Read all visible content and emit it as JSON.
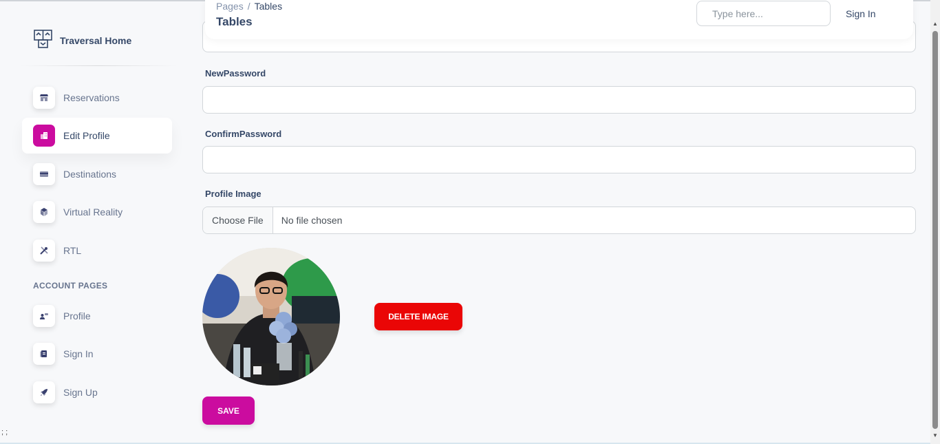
{
  "sidebar": {
    "brand_title": "Traversal Home",
    "items": [
      {
        "label": "Reservations",
        "icon": "shop-icon",
        "active": false
      },
      {
        "label": "Edit Profile",
        "icon": "office-icon",
        "active": true
      },
      {
        "label": "Destinations",
        "icon": "credit-card-icon",
        "active": false
      },
      {
        "label": "Virtual Reality",
        "icon": "box-3d-icon",
        "active": false
      },
      {
        "label": "RTL",
        "icon": "settings-tools-icon",
        "active": false
      }
    ],
    "section_title": "ACCOUNT PAGES",
    "account_items": [
      {
        "label": "Profile",
        "icon": "customer-support-icon"
      },
      {
        "label": "Sign In",
        "icon": "document-icon"
      },
      {
        "label": "Sign Up",
        "icon": "spaceship-icon"
      }
    ],
    "footer_text": "; ;"
  },
  "navbar": {
    "breadcrumb_root": "Pages",
    "breadcrumb_separator": "/",
    "breadcrumb_current": "Tables",
    "page_title": "Tables",
    "search_placeholder": "Type here...",
    "sign_in_label": "Sign In"
  },
  "form": {
    "new_password_label": "NewPassword",
    "confirm_password_label": "ConfirmPassword",
    "profile_image_label": "Profile Image",
    "choose_file_label": "Choose File",
    "file_status": "No file chosen",
    "delete_image_label": "DELETE IMAGE",
    "save_label": "SAVE"
  },
  "colors": {
    "primary": "#cb0c9f",
    "danger": "#ea0606",
    "text_dark": "#344767",
    "text_muted": "#67748e",
    "background": "#f7f8fa"
  }
}
